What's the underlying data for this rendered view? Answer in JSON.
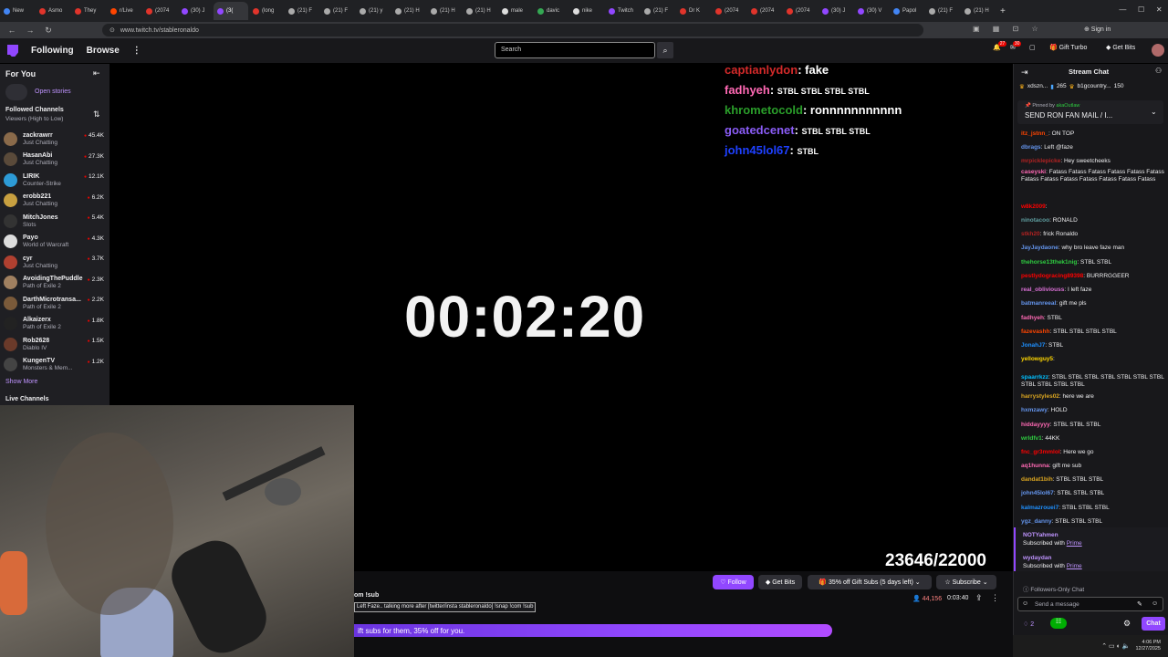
{
  "browser": {
    "tabs": [
      {
        "label": "New",
        "color": "#4285f4"
      },
      {
        "label": "Asmo",
        "color": "#e0342b"
      },
      {
        "label": "They",
        "color": "#e0342b"
      },
      {
        "label": "r/Live",
        "color": "#ff4500"
      },
      {
        "label": "(2074",
        "color": "#e0342b"
      },
      {
        "label": "(30) J",
        "color": "#9147ff"
      },
      {
        "label": "(3(",
        "color": "#9147ff",
        "active": true
      },
      {
        "label": "(long",
        "color": "#e0342b"
      },
      {
        "label": "(21) F",
        "color": "#aaaaaa"
      },
      {
        "label": "(21) F",
        "color": "#aaaaaa"
      },
      {
        "label": "(21) y",
        "color": "#aaaaaa"
      },
      {
        "label": "(21) H",
        "color": "#aaaaaa"
      },
      {
        "label": "(21) H",
        "color": "#aaaaaa"
      },
      {
        "label": "(21) H",
        "color": "#aaaaaa"
      },
      {
        "label": "male",
        "color": "#dddddd"
      },
      {
        "label": "davic",
        "color": "#34a853"
      },
      {
        "label": "nike",
        "color": "#dddddd"
      },
      {
        "label": "Twitch",
        "color": "#9147ff"
      },
      {
        "label": "(21) F",
        "color": "#aaaaaa"
      },
      {
        "label": "Dr K",
        "color": "#e0342b"
      },
      {
        "label": "(2074",
        "color": "#e0342b"
      },
      {
        "label": "(2074",
        "color": "#e0342b"
      },
      {
        "label": "(2074",
        "color": "#e0342b"
      },
      {
        "label": "(30) J",
        "color": "#9147ff"
      },
      {
        "label": "(30) V",
        "color": "#9147ff"
      },
      {
        "label": "Papol",
        "color": "#4285f4"
      },
      {
        "label": "(21) F",
        "color": "#aaaaaa"
      },
      {
        "label": "(21) H",
        "color": "#aaaaaa"
      }
    ],
    "new_tab_symbol": "+",
    "url": "www.twitch.tv/stableronaldo"
  },
  "topnav": {
    "following": "Following",
    "browse": "Browse",
    "more": "⋮",
    "search_placeholder": "Search",
    "notif_count": "27",
    "inbox_count": "30",
    "gift_turbo": "Gift Turbo",
    "get_bits": "Get Bits"
  },
  "sidebar": {
    "for_you": "For You",
    "open_stories": "Open stories",
    "followed_channels": "Followed Channels",
    "sort": "Viewers (High to Low)",
    "channels": [
      {
        "name": "zackrawrr",
        "game": "Just Chatting",
        "viewers": "45.4K",
        "color": "#8a6a4a"
      },
      {
        "name": "HasanAbi",
        "game": "Just Chatting",
        "viewers": "27.3K",
        "color": "#5a4a3a"
      },
      {
        "name": "LIRIK",
        "game": "Counter-Strike",
        "viewers": "12.1K",
        "color": "#2d9bd6"
      },
      {
        "name": "erobb221",
        "game": "Just Chatting",
        "viewers": "6.2K",
        "color": "#c8a040"
      },
      {
        "name": "MitchJones",
        "game": "Slots",
        "viewers": "5.4K",
        "color": "#333333"
      },
      {
        "name": "Payo",
        "game": "World of Warcraft",
        "viewers": "4.3K",
        "color": "#dddddd"
      },
      {
        "name": "cyr",
        "game": "Just Chatting",
        "viewers": "3.7K",
        "color": "#b04030"
      },
      {
        "name": "AvoidingThePuddle",
        "game": "Path of Exile 2",
        "viewers": "2.3K",
        "color": "#a08060"
      },
      {
        "name": "DarthMicrotransa...",
        "game": "Path of Exile 2",
        "viewers": "2.2K",
        "color": "#7a5a3a"
      },
      {
        "name": "Alkaizerx",
        "game": "Path of Exile 2",
        "viewers": "1.8K",
        "color": "#222222"
      },
      {
        "name": "Rob2628",
        "game": "Diablo IV",
        "viewers": "1.5K",
        "color": "#6a3a2a"
      },
      {
        "name": "KungenTV",
        "game": "Monsters & Mem...",
        "viewers": "1.2K",
        "color": "#444444"
      }
    ],
    "show_more": "Show More",
    "live_channels": "Live Channels"
  },
  "player": {
    "timer": "00:02:20",
    "counter": "23646/22000",
    "overlay_chat": [
      {
        "user": "captianlydon",
        "text": "fake",
        "color": "#d42a2a"
      },
      {
        "user": "fadhyeh",
        "text": "STBL STBL STBL STBL",
        "color": "#ff69b4"
      },
      {
        "user": "khrometocold",
        "text": "ronnnnnnnnnnn",
        "color": "#2a9d2a"
      },
      {
        "user": "goatedcenet",
        "text": "STBL STBL STBL",
        "color": "#8a5cf6"
      },
      {
        "user": "john45lol67",
        "text": "STBL",
        "color": "#1e40ff"
      }
    ]
  },
  "below": {
    "follow": "Follow",
    "get_bits": "Get Bits",
    "gift_subs": "35% off Gift Subs (5 days left)",
    "subscribe": "Subscribe",
    "title_fragment": "om !sub",
    "tags": "Left Faze.. talking more after [twitter/insta stableronaldo] !snap !com !sub",
    "viewers": "44,156",
    "uptime": "0:03:40",
    "banner": "ift subs for them, 35% off for you."
  },
  "chat": {
    "header": "Stream Chat",
    "top_user1": "xdszn...",
    "top_user1_count": "265",
    "top_user2": "b1gcountry...",
    "top_user2_count": "150",
    "pinned_by": "Pinned by",
    "pinned_author": "akaOutlaw",
    "pinned_text": "SEND RON FAN MAIL / I...",
    "messages": [
      {
        "user": "itz_jstnn_",
        "text": "ON TOP",
        "color": "#ff4500"
      },
      {
        "user": "dbrags",
        "text": "Left @faze",
        "color": "#6495ed"
      },
      {
        "user": "mrpicklepicke",
        "text": "Hey sweetcheeks",
        "color": "#b22222"
      },
      {
        "user": "caseyski",
        "text": "Fatass Fatass Fatass Fatass Fatass Fatass Fatass Fatass Fatass Fatass Fatass Fatass Fatass",
        "color": "#ff69b4"
      },
      {
        "user": "w8k2009",
        "text": "",
        "color": "#ff0000"
      },
      {
        "user": "ninotacoo",
        "text": "RONALD",
        "color": "#5f9ea0"
      },
      {
        "user": "stkh20",
        "text": "frick Ronaldo",
        "color": "#b22222"
      },
      {
        "user": "JayJaydaone",
        "text": "why bro leave faze man",
        "color": "#6495ed"
      },
      {
        "user": "thehorse13thek1nig",
        "text": "STBL STBL",
        "color": "#2ecc40"
      },
      {
        "user": "pestlydogracing89398",
        "text": "BURRRGGEER",
        "color": "#ff0000"
      },
      {
        "user": "real_obliviouss",
        "text": "I left faze",
        "color": "#da70d6"
      },
      {
        "user": "batmanreeal",
        "text": "gift me pls",
        "color": "#6495ed"
      },
      {
        "user": "fadhyeh",
        "text": "STBL",
        "color": "#ff69b4"
      },
      {
        "user": "fazevashh",
        "text": "STBL STBL STBL STBL",
        "color": "#ff4500"
      },
      {
        "user": "JonahJ7",
        "text": "STBL",
        "color": "#1e90ff"
      },
      {
        "user": "yellowguy5",
        "text": "",
        "color": "#ffd700"
      },
      {
        "user": "spaarrkzz",
        "text": "STBL STBL STBL STBL STBL STBL STBL STBL STBL STBL STBL",
        "color": "#00bfff"
      },
      {
        "user": "harrystyles02",
        "text": "here we are",
        "color": "#daa520"
      },
      {
        "user": "hxmzawy",
        "text": "HOLD",
        "color": "#6495ed"
      },
      {
        "user": "hiddayyyy",
        "text": "STBL STBL STBL",
        "color": "#ff69b4"
      },
      {
        "user": "wrldfv1",
        "text": "44KK",
        "color": "#2ecc40"
      },
      {
        "user": "fnc_gr3mmlol",
        "text": "Here we go",
        "color": "#ff0000"
      },
      {
        "user": "aq1hunna",
        "text": "gift me sub",
        "color": "#ff69b4"
      },
      {
        "user": "dandat1bih",
        "text": "STBL STBL STBL",
        "color": "#daa520"
      },
      {
        "user": "john45lol67",
        "text": "STBL STBL STBL",
        "color": "#6495ed"
      },
      {
        "user": "kalmazrouei7",
        "text": "STBL STBL STBL",
        "color": "#1e90ff"
      },
      {
        "user": "ygz_danny",
        "text": "STBL STBL STBL",
        "color": "#6495ed"
      }
    ],
    "subs": [
      {
        "user": "NOTYahmen",
        "text": "Subscribed with",
        "prime": "Prime"
      },
      {
        "user": "wydaydan",
        "text": "Subscribed with",
        "prime": "Prime"
      }
    ],
    "followers_only": "Followers-Only Chat",
    "send_placeholder": "Send a message",
    "points": "2",
    "chat_button": "Chat",
    "clock_time": "4:06 PM",
    "clock_date": "12/27/2025"
  }
}
